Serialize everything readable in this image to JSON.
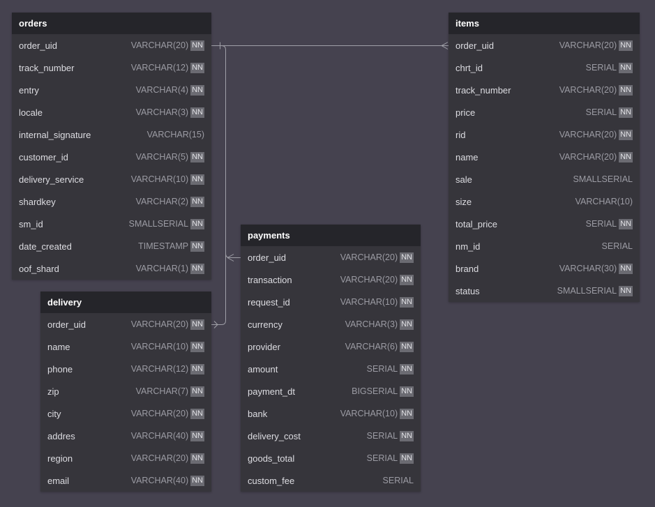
{
  "colors": {
    "canvas": "#45424f",
    "table_body": "#36353b",
    "table_header": "#25252a",
    "badge": "#6b6b72",
    "line": "#a0a0a8"
  },
  "tables": [
    {
      "name": "orders",
      "fields": [
        {
          "name": "order_uid",
          "type": "VARCHAR(20)",
          "nn": "NN"
        },
        {
          "name": "track_number",
          "type": "VARCHAR(12)",
          "nn": "NN"
        },
        {
          "name": "entry",
          "type": "VARCHAR(4)",
          "nn": "NN"
        },
        {
          "name": "locale",
          "type": "VARCHAR(3)",
          "nn": "NN"
        },
        {
          "name": "internal_signature",
          "type": "VARCHAR(15)",
          "nn": ""
        },
        {
          "name": "customer_id",
          "type": "VARCHAR(5)",
          "nn": "NN"
        },
        {
          "name": "delivery_service",
          "type": "VARCHAR(10)",
          "nn": "NN"
        },
        {
          "name": "shardkey",
          "type": "VARCHAR(2)",
          "nn": "NN"
        },
        {
          "name": "sm_id",
          "type": "SMALLSERIAL",
          "nn": "NN"
        },
        {
          "name": "date_created",
          "type": "TIMESTAMP",
          "nn": "NN"
        },
        {
          "name": "oof_shard",
          "type": "VARCHAR(1)",
          "nn": "NN"
        }
      ]
    },
    {
      "name": "items",
      "fields": [
        {
          "name": "order_uid",
          "type": "VARCHAR(20)",
          "nn": "NN"
        },
        {
          "name": "chrt_id",
          "type": "SERIAL",
          "nn": "NN"
        },
        {
          "name": "track_number",
          "type": "VARCHAR(20)",
          "nn": "NN"
        },
        {
          "name": "price",
          "type": "SERIAL",
          "nn": "NN"
        },
        {
          "name": "rid",
          "type": "VARCHAR(20)",
          "nn": "NN"
        },
        {
          "name": "name",
          "type": "VARCHAR(20)",
          "nn": "NN"
        },
        {
          "name": "sale",
          "type": "SMALLSERIAL",
          "nn": ""
        },
        {
          "name": "size",
          "type": "VARCHAR(10)",
          "nn": ""
        },
        {
          "name": "total_price",
          "type": "SERIAL",
          "nn": "NN"
        },
        {
          "name": "nm_id",
          "type": "SERIAL",
          "nn": ""
        },
        {
          "name": "brand",
          "type": "VARCHAR(30)",
          "nn": "NN"
        },
        {
          "name": "status",
          "type": "SMALLSERIAL",
          "nn": "NN"
        }
      ]
    },
    {
      "name": "payments",
      "fields": [
        {
          "name": "order_uid",
          "type": "VARCHAR(20)",
          "nn": "NN"
        },
        {
          "name": "transaction",
          "type": "VARCHAR(20)",
          "nn": "NN"
        },
        {
          "name": "request_id",
          "type": "VARCHAR(10)",
          "nn": "NN"
        },
        {
          "name": "currency",
          "type": "VARCHAR(3)",
          "nn": "NN"
        },
        {
          "name": "provider",
          "type": "VARCHAR(6)",
          "nn": "NN"
        },
        {
          "name": "amount",
          "type": "SERIAL",
          "nn": "NN"
        },
        {
          "name": "payment_dt",
          "type": "BIGSERIAL",
          "nn": "NN"
        },
        {
          "name": "bank",
          "type": "VARCHAR(10)",
          "nn": "NN"
        },
        {
          "name": "delivery_cost",
          "type": "SERIAL",
          "nn": "NN"
        },
        {
          "name": "goods_total",
          "type": "SERIAL",
          "nn": "NN"
        },
        {
          "name": "custom_fee",
          "type": "SERIAL",
          "nn": ""
        }
      ]
    },
    {
      "name": "delivery",
      "fields": [
        {
          "name": "order_uid",
          "type": "VARCHAR(20)",
          "nn": "NN"
        },
        {
          "name": "name",
          "type": "VARCHAR(10)",
          "nn": "NN"
        },
        {
          "name": "phone",
          "type": "VARCHAR(12)",
          "nn": "NN"
        },
        {
          "name": "zip",
          "type": "VARCHAR(7)",
          "nn": "NN"
        },
        {
          "name": "city",
          "type": "VARCHAR(20)",
          "nn": "NN"
        },
        {
          "name": "addres",
          "type": "VARCHAR(40)",
          "nn": "NN"
        },
        {
          "name": "region",
          "type": "VARCHAR(20)",
          "nn": "NN"
        },
        {
          "name": "email",
          "type": "VARCHAR(40)",
          "nn": "NN"
        }
      ]
    }
  ],
  "relations": [
    {
      "from": "orders.order_uid",
      "to": "items.order_uid",
      "type": "one-to-many"
    },
    {
      "from": "orders.order_uid",
      "to": "payments.order_uid",
      "type": "one-to-many"
    },
    {
      "from": "orders.order_uid",
      "to": "delivery.order_uid",
      "type": "one-to-one"
    }
  ]
}
